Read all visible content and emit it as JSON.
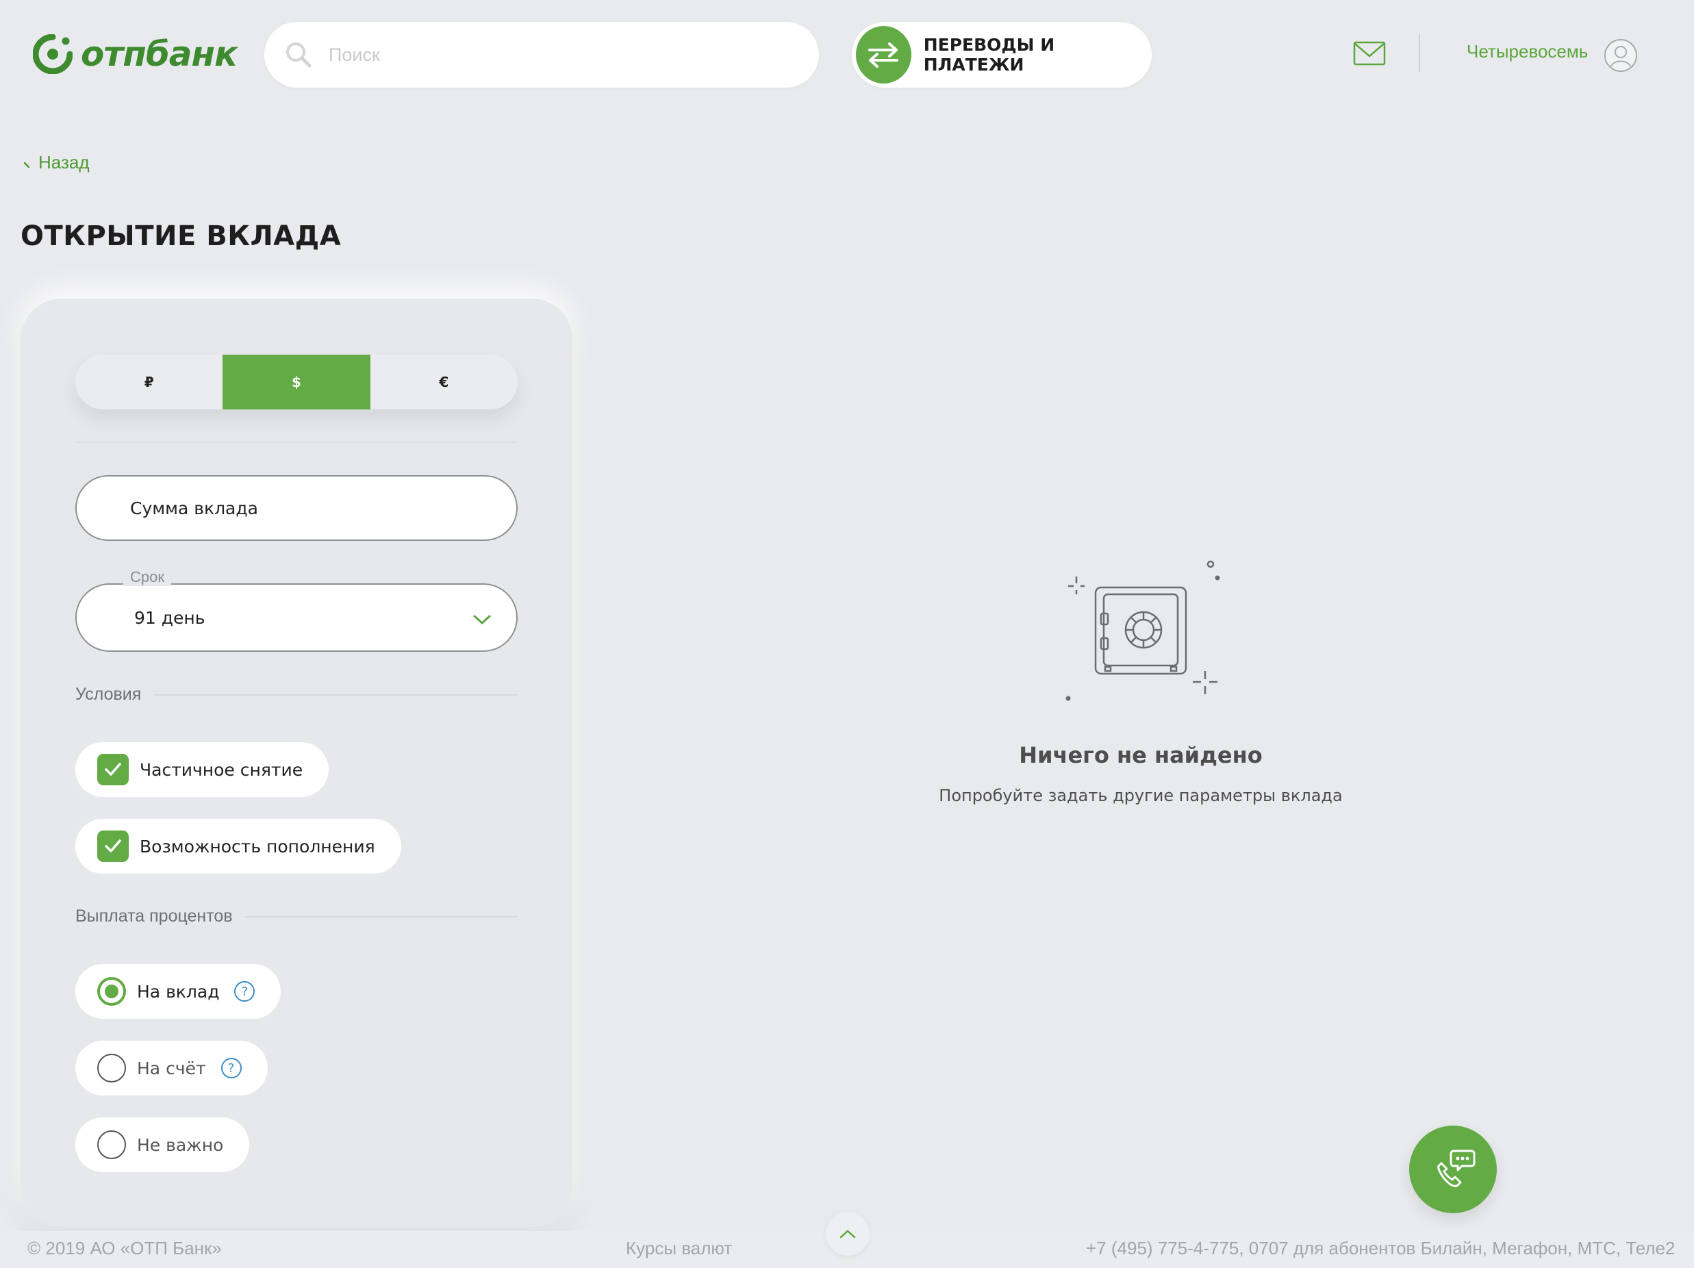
{
  "brand": {
    "logo_text": "отпбанк",
    "accent": "#62ab45"
  },
  "header": {
    "search_placeholder": "Поиск",
    "transfers_label": "ПЕРЕВОДЫ И ПЛАТЕЖИ",
    "user_name": "Четыревосемь"
  },
  "nav": {
    "back_label": "Назад"
  },
  "page": {
    "title": "ОТКРЫТИЕ ВКЛАДА"
  },
  "filters": {
    "currency": [
      {
        "symbol": "₽",
        "active": false
      },
      {
        "symbol": "$",
        "active": true
      },
      {
        "symbol": "€",
        "active": false
      }
    ],
    "amount_placeholder": "Сумма вклада",
    "term_legend": "Срок",
    "term_value": "91 день",
    "conditions_label": "Условия",
    "conditions": [
      {
        "label": "Частичное снятие",
        "checked": true
      },
      {
        "label": "Возможность пополнения",
        "checked": true
      }
    ],
    "payout_label": "Выплата процентов",
    "payout_options": [
      {
        "label": "На вклад",
        "selected": true,
        "help": true
      },
      {
        "label": "На счёт",
        "selected": false,
        "help": true
      },
      {
        "label": "Не важно",
        "selected": false,
        "help": false
      }
    ],
    "help_glyph": "?"
  },
  "empty_state": {
    "title": "Ничего не найдено",
    "subtitle": "Попробуйте задать другие параметры вклада"
  },
  "footer": {
    "copyright": "© 2019 АО «ОТП Банк»",
    "rates": "Курсы валют",
    "phones": "+7 (495) 775-4-775,  0707 для абонентов Билайн, Мегафон, МТС, Теле2"
  },
  "icons": {
    "search": "search-icon",
    "transfer": "transfer-arrows-icon",
    "mail": "mail-icon",
    "avatar": "user-avatar-icon",
    "back": "chevron-left-icon",
    "dropdown": "chevron-down-icon",
    "check": "check-icon",
    "help": "help-icon",
    "safe": "safe-icon",
    "chat": "phone-chat-icon",
    "up": "chevron-up-icon"
  }
}
